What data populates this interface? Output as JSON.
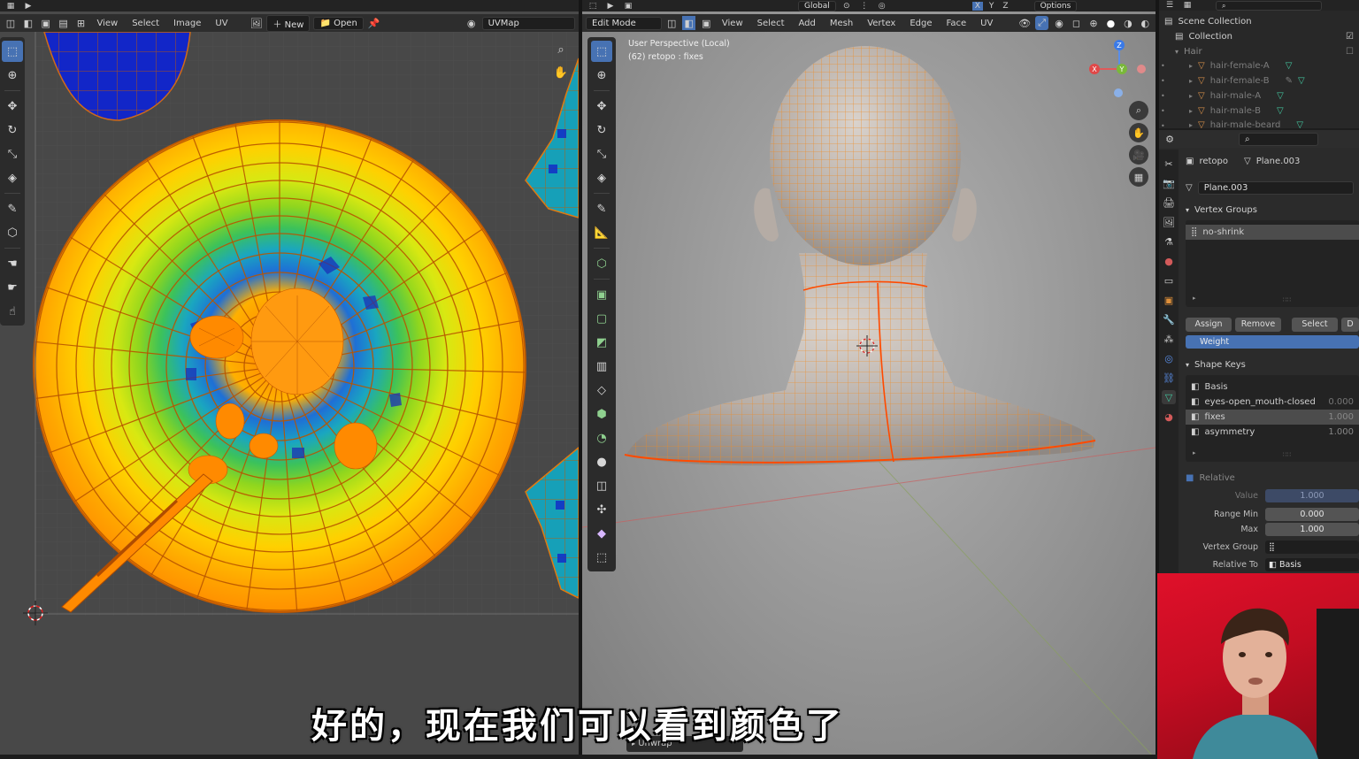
{
  "uv_editor": {
    "menu": [
      "View",
      "Select",
      "Image",
      "UV"
    ],
    "new_label": "New",
    "open_label": "Open",
    "uvmap_name": "UVMap"
  },
  "viewport": {
    "mode": "Edit Mode",
    "orientation": "Global",
    "menu": [
      "View",
      "Select",
      "Add",
      "Mesh",
      "Vertex",
      "Edge",
      "Face",
      "UV"
    ],
    "options_label": "Options",
    "overlay_title": "User Perspective (Local)",
    "overlay_subtitle": "(62) retopo : fixes",
    "gizmo": {
      "z": "Z",
      "y": "Y",
      "x": "X"
    },
    "last_op": "Unwrap",
    "xyz_toggles": [
      "X",
      "Y",
      "Z"
    ]
  },
  "outliner": {
    "scene_collection": "Scene Collection",
    "collection": "Collection",
    "hair": "Hair",
    "items": [
      "hair-female-A",
      "hair-female-B",
      "hair-male-A",
      "hair-male-B",
      "hair-male-beard"
    ]
  },
  "properties": {
    "object_name": "retopo",
    "mesh_name": "Plane.003",
    "data_name": "Plane.003",
    "vertex_groups_title": "Vertex Groups",
    "vertex_group_item": "no-shrink",
    "assign": "Assign",
    "remove": "Remove",
    "select": "Select",
    "deselect_short": "D",
    "weight_label": "Weight",
    "shape_keys_title": "Shape Keys",
    "shape_keys": [
      {
        "name": "Basis",
        "value": ""
      },
      {
        "name": "eyes-open_mouth-closed",
        "value": "0.000"
      },
      {
        "name": "fixes",
        "value": "1.000"
      },
      {
        "name": "asymmetry",
        "value": "1.000"
      }
    ],
    "relative_label": "Relative",
    "value_label": "Value",
    "value": "1.000",
    "range_min_label": "Range Min",
    "range_min": "0.000",
    "max_label": "Max",
    "max": "1.000",
    "vertex_group_label": "Vertex Group",
    "relative_to_label": "Relative To",
    "relative_to": "Basis"
  },
  "subtitle": "好的，现在我们可以看到颜色了",
  "colors": {
    "accent": "#4772b3",
    "orange": "#ff9a00",
    "uv_bg": "#5a5a5a",
    "viewport_bg": "#9a9a9a"
  }
}
